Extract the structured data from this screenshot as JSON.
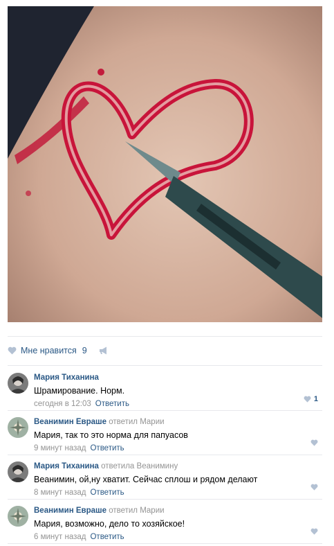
{
  "post": {
    "image_desc_icon": "photo",
    "likes": {
      "label": "Мне нравится",
      "count": "9"
    },
    "share_icon": "megaphone-icon"
  },
  "comments": [
    {
      "author": "Мария Тиханина",
      "replied": "",
      "replied_to": "",
      "text": "Шрамирование. Норм.",
      "time": "сегодня в 12:03",
      "reply_label": "Ответить",
      "likes": "1",
      "avatar": "avatar-maria"
    },
    {
      "author": "Веанимин Евраше",
      "replied": "ответил",
      "replied_to": "Марии",
      "text": "Мария, так то это норма для папуасов",
      "time": "9 минут назад",
      "reply_label": "Ответить",
      "likes": "",
      "avatar": "avatar-veanimin"
    },
    {
      "author": "Мария Тиханина",
      "replied": "ответила",
      "replied_to": "Веанимину",
      "text": "Веанимин, ой,ну хватит. Сейчас сплош и рядом делают",
      "time": "8 минут назад",
      "reply_label": "Ответить",
      "likes": "",
      "avatar": "avatar-maria"
    },
    {
      "author": "Веанимин Евраше",
      "replied": "ответил",
      "replied_to": "Марии",
      "text": "Мария, возможно, дело то хозяйское!",
      "time": "6 минут назад",
      "reply_label": "Ответить",
      "likes": "",
      "avatar": "avatar-veanimin"
    }
  ],
  "colors": {
    "link": "#2a5885",
    "muted": "#939393",
    "divider": "#e7e8ec",
    "heart": "#b3c1d3"
  }
}
